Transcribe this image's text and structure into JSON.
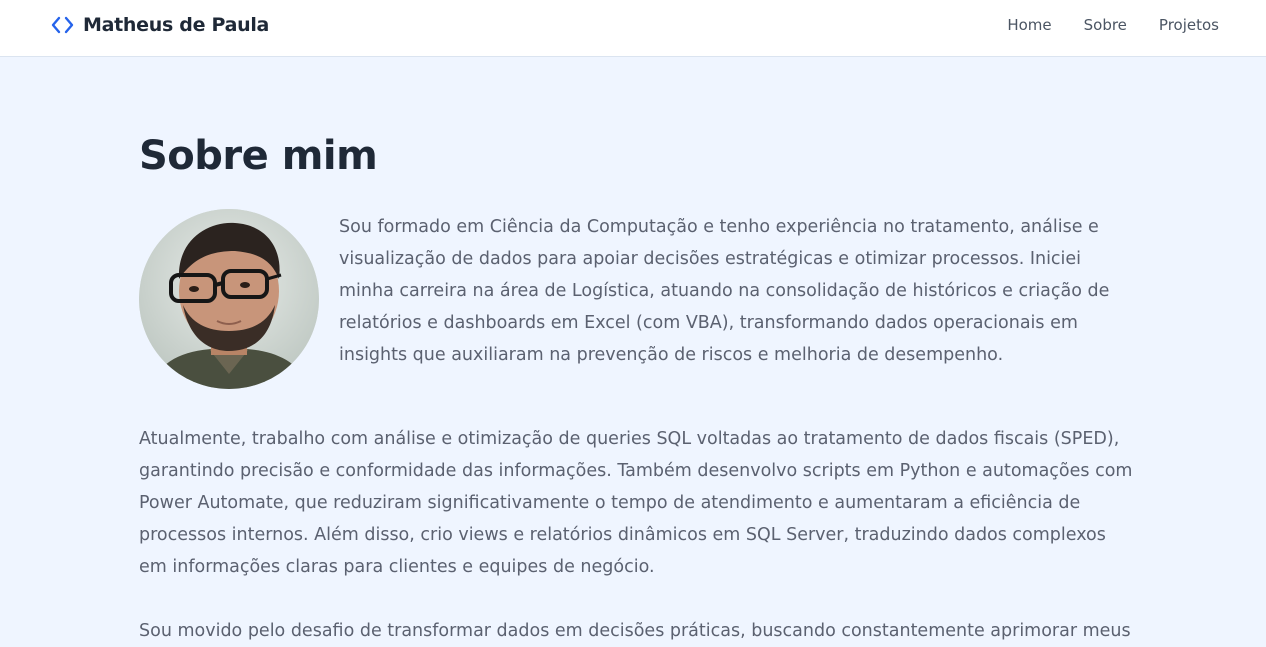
{
  "header": {
    "brand_name": "Matheus de Paula",
    "brand_icon": "code-icon",
    "accent_color": "#2563eb",
    "nav": [
      {
        "label": "Home"
      },
      {
        "label": "Sobre"
      },
      {
        "label": "Projetos"
      }
    ]
  },
  "about": {
    "title": "Sobre mim",
    "paragraphs": [
      "Sou formado em Ciência da Computação e tenho experiência no tratamento, análise e visualização de dados para apoiar decisões estratégicas e otimizar processos. Iniciei minha carreira na área de Logística, atuando na consolidação de históricos e criação de relatórios e dashboards em Excel (com VBA), transformando dados operacionais em insights que auxiliaram na prevenção de riscos e melhoria de desempenho.",
      "Atualmente, trabalho com análise e otimização de queries SQL voltadas ao tratamento de dados fiscais (SPED), garantindo precisão e conformidade das informações. Também desenvolvo scripts em Python e automações com Power Automate, que reduziram significativamente o tempo de atendimento e aumentaram a eficiência de processos internos. Além disso, crio views e relatórios dinâmicos em SQL Server, traduzindo dados complexos em informações claras para clientes e equipes de negócio.",
      "Sou movido pelo desafio de transformar dados em decisões práticas, buscando constantemente aprimorar meus"
    ]
  }
}
